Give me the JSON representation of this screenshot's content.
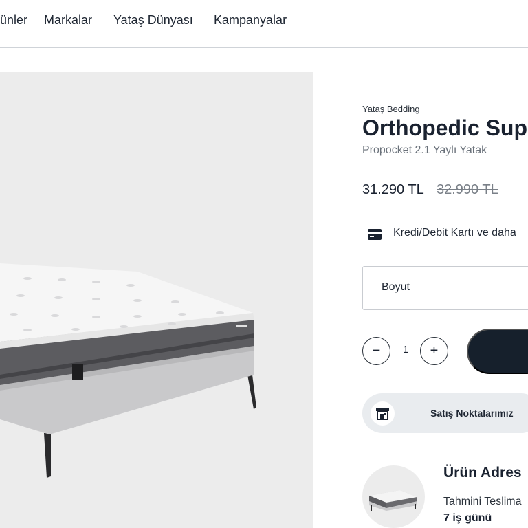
{
  "nav": {
    "items": [
      {
        "label": "ünler"
      },
      {
        "label": "Markalar"
      },
      {
        "label": "Yataş Dünyası"
      },
      {
        "label": "Kampanyalar"
      }
    ]
  },
  "product": {
    "brand": "Yataş Bedding",
    "title": "Orthopedic Supp",
    "subtitle": "Propocket 2.1 Yaylı Yatak",
    "price": "31.290 TL",
    "old_price": "32.990 TL",
    "payment_text": "Kredi/Debit Kartı ve daha",
    "size_label": "Boyut",
    "quantity": "1",
    "quantity_minus": "−",
    "quantity_plus": "+"
  },
  "stores": {
    "label": "Satış Noktalarımız"
  },
  "delivery": {
    "title": "Ürün Adres",
    "label": "Tahmini Teslima",
    "value": "7 iş günü"
  },
  "icons": {
    "payment": "credit-card-icon",
    "stores": "store-icon"
  },
  "colors": {
    "primary": "#16202c",
    "image_bg": "#ececec",
    "stores_bg": "#e9ecef"
  }
}
